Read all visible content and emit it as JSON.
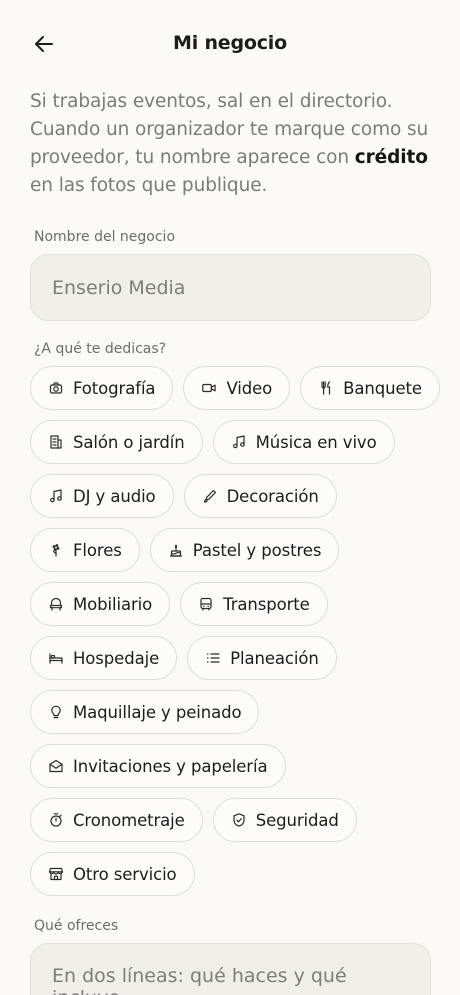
{
  "header": {
    "title": "Mi negocio"
  },
  "intro": {
    "before": "Si trabajas eventos, sal en el directorio. Cuando un organizador te marque como su proveedor, tu nombre aparece con ",
    "bold": "crédito",
    "after": " en las fotos que publique."
  },
  "business_name": {
    "label": "Nombre del negocio",
    "value": "Enserio Media"
  },
  "categories": {
    "label": "¿A qué te dedicas?",
    "items": [
      {
        "label": "Fotografía",
        "icon": "camera-icon"
      },
      {
        "label": "Video",
        "icon": "video-icon"
      },
      {
        "label": "Banquete",
        "icon": "utensils-icon"
      },
      {
        "label": "Salón o jardín",
        "icon": "building-icon"
      },
      {
        "label": "Música en vivo",
        "icon": "music-note-icon"
      },
      {
        "label": "DJ y audio",
        "icon": "music-note-icon"
      },
      {
        "label": "Decoración",
        "icon": "brush-icon"
      },
      {
        "label": "Flores",
        "icon": "flower-icon"
      },
      {
        "label": "Pastel y postres",
        "icon": "cake-icon"
      },
      {
        "label": "Mobiliario",
        "icon": "chair-icon"
      },
      {
        "label": "Transporte",
        "icon": "bus-icon"
      },
      {
        "label": "Hospedaje",
        "icon": "bed-icon"
      },
      {
        "label": "Planeación",
        "icon": "list-icon"
      },
      {
        "label": "Maquillaje y peinado",
        "icon": "lightbulb-icon"
      },
      {
        "label": "Invitaciones y papelería",
        "icon": "envelope-icon"
      },
      {
        "label": "Cronometraje",
        "icon": "stopwatch-icon"
      },
      {
        "label": "Seguridad",
        "icon": "shield-icon"
      },
      {
        "label": "Otro servicio",
        "icon": "store-icon"
      }
    ]
  },
  "offer": {
    "label": "Qué ofreces",
    "placeholder": "En dos líneas: qué haces y qué incluye."
  }
}
